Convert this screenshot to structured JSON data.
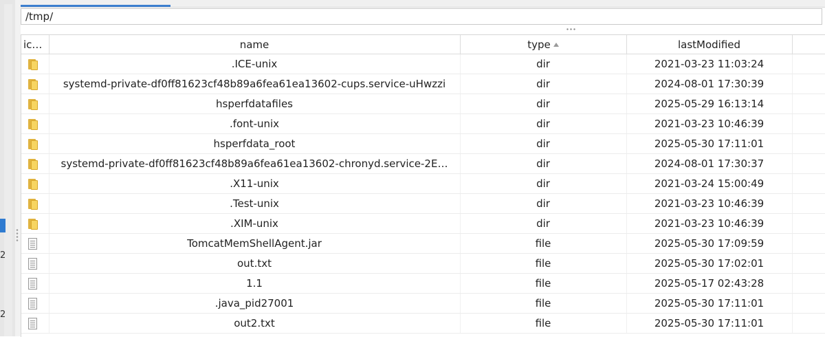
{
  "path": "/tmp/",
  "sidebar": {
    "numbers": [
      "2",
      "2"
    ]
  },
  "table": {
    "columns": {
      "icon": "icon",
      "name": "name",
      "type": "type",
      "lastModified": "lastModified"
    },
    "rows": [
      {
        "icon": "folder-icon",
        "name": ".ICE-unix",
        "type": "dir",
        "lastModified": "2021-03-23 11:03:24"
      },
      {
        "icon": "folder-icon",
        "name": "systemd-private-df0ff81623cf48b89a6fea61ea13602-cups.service-uHwzzi",
        "type": "dir",
        "lastModified": "2024-08-01 17:30:39"
      },
      {
        "icon": "folder-icon",
        "name": "hsperfdatafiles",
        "type": "dir",
        "lastModified": "2025-05-29 16:13:14"
      },
      {
        "icon": "folder-icon",
        "name": ".font-unix",
        "type": "dir",
        "lastModified": "2021-03-23 10:46:39"
      },
      {
        "icon": "folder-icon",
        "name": "hsperfdata_root",
        "type": "dir",
        "lastModified": "2025-05-30 17:11:01"
      },
      {
        "icon": "folder-icon",
        "name": "systemd-private-df0ff81623cf48b89a6fea61ea13602-chronyd.service-2E…",
        "type": "dir",
        "lastModified": "2024-08-01 17:30:37"
      },
      {
        "icon": "folder-icon",
        "name": ".X11-unix",
        "type": "dir",
        "lastModified": "2021-03-24 15:00:49"
      },
      {
        "icon": "folder-icon",
        "name": ".Test-unix",
        "type": "dir",
        "lastModified": "2021-03-23 10:46:39"
      },
      {
        "icon": "folder-icon",
        "name": ".XIM-unix",
        "type": "dir",
        "lastModified": "2021-03-23 10:46:39"
      },
      {
        "icon": "file-icon",
        "name": "TomcatMemShellAgent.jar",
        "type": "file",
        "lastModified": "2025-05-30 17:09:59"
      },
      {
        "icon": "file-icon",
        "name": "out.txt",
        "type": "file",
        "lastModified": "2025-05-30 17:02:01"
      },
      {
        "icon": "file-icon",
        "name": "1.1",
        "type": "file",
        "lastModified": "2025-05-17 02:43:28"
      },
      {
        "icon": "file-icon",
        "name": ".java_pid27001",
        "type": "file",
        "lastModified": "2025-05-30 17:11:01"
      },
      {
        "icon": "file-icon",
        "name": "out2.txt",
        "type": "file",
        "lastModified": "2025-05-30 17:11:01"
      }
    ]
  }
}
